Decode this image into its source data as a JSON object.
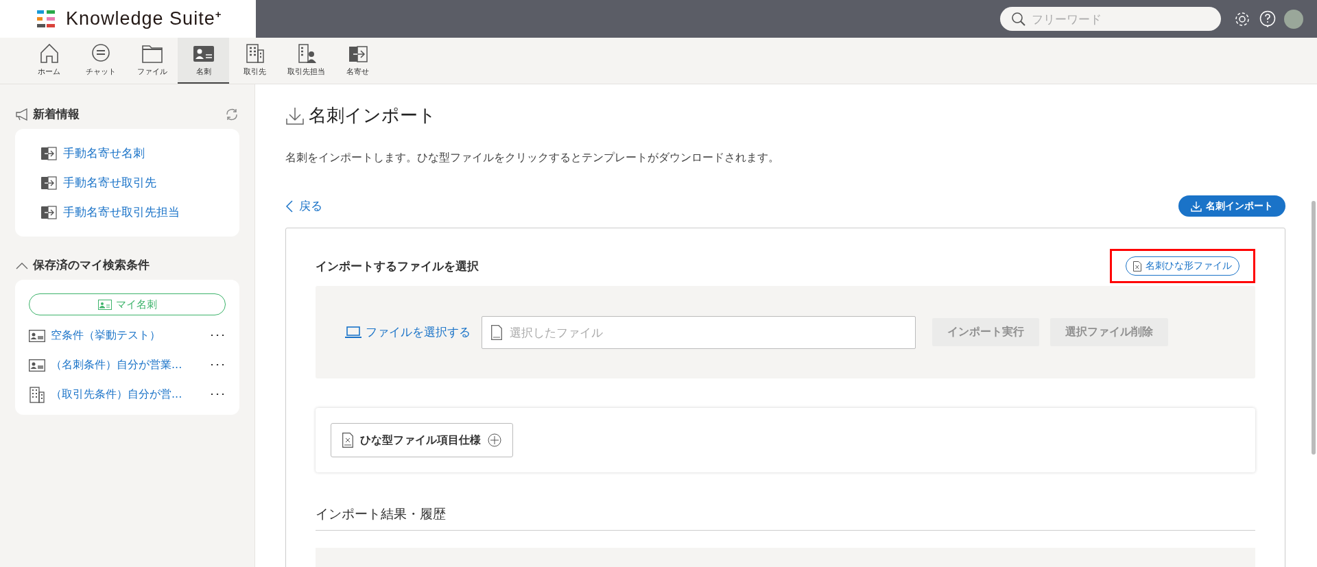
{
  "header": {
    "logo_text": "Knowledge Suite",
    "logo_mark": "+",
    "search": {
      "placeholder": "フリーワード"
    }
  },
  "nav": [
    {
      "label": "ホーム",
      "kind": "home",
      "selected": false
    },
    {
      "label": "チャット",
      "kind": "chat",
      "selected": false
    },
    {
      "label": "ファイル",
      "kind": "folder",
      "selected": false
    },
    {
      "label": "名刺",
      "kind": "card",
      "selected": true
    },
    {
      "label": "取引先",
      "kind": "company",
      "selected": false
    },
    {
      "label": "取引先担当",
      "kind": "contact",
      "selected": false
    },
    {
      "label": "名寄せ",
      "kind": "merge",
      "selected": false
    }
  ],
  "sidebar": {
    "news": {
      "title": "新着情報",
      "items": [
        "手動名寄せ名刺",
        "手動名寄せ取引先",
        "手動名寄せ取引先担当"
      ]
    },
    "saved": {
      "title": "保存済のマイ検索条件",
      "expanded": true,
      "my_card": "マイ名刺",
      "items": [
        {
          "label": "空条件（挙動テスト）",
          "kind": "card",
          "menu": "･･･"
        },
        {
          "label": "（名刺条件）自分が営業...",
          "kind": "card",
          "menu": "･･･"
        },
        {
          "label": "（取引先条件）自分が営...",
          "kind": "company",
          "menu": "･･･"
        }
      ]
    }
  },
  "main": {
    "title": "名刺インポート",
    "description": "名刺をインポートします。ひな型ファイルをクリックするとテンプレートがダウンロードされます。",
    "back": "戻る",
    "import_button": "名刺インポート",
    "panel": {
      "heading": "インポートするファイルを選択",
      "template_button": {
        "label": "名刺ひな形ファイル",
        "highlighted": true
      },
      "choose_file": "ファイルを選択する",
      "file_field": {
        "placeholder": "選択したファイル"
      },
      "actions": [
        {
          "label": "インポート実行",
          "disabled": true
        },
        {
          "label": "選択ファイル削除",
          "disabled": true
        }
      ],
      "spec_button": "ひな型ファイル項目仕様",
      "history_heading": "インポート結果・履歴"
    }
  }
}
